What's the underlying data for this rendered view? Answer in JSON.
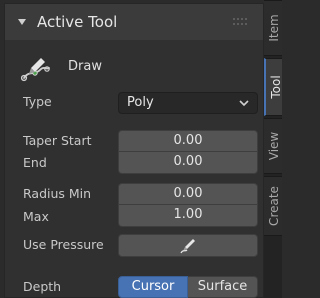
{
  "panel": {
    "title": "Active Tool",
    "tool_name": "Draw"
  },
  "properties": {
    "type_label": "Type",
    "type_value": "Poly",
    "taper_start_label": "Taper Start",
    "taper_start_value": "0.00",
    "end_label": "End",
    "end_value": "0.00",
    "radius_min_label": "Radius Min",
    "radius_min_value": "0.00",
    "max_label": "Max",
    "max_value": "1.00",
    "use_pressure_label": "Use Pressure",
    "depth_label": "Depth",
    "depth_options": [
      "Cursor",
      "Surface"
    ],
    "depth_selected": "Cursor"
  },
  "sidebar": {
    "tabs": [
      {
        "label": "Item",
        "active": false
      },
      {
        "label": "Tool",
        "active": true
      },
      {
        "label": "View",
        "active": false
      },
      {
        "label": "Create",
        "active": false
      }
    ]
  },
  "colors": {
    "accent": "#4772b3",
    "panel_bg": "#303030",
    "field_bg": "#545454"
  },
  "icons": {
    "header": "disclosure-triangle-down-icon",
    "tool": "draw-brush-icon",
    "pressure": "pen-pressure-icon",
    "dropdown": "chevron-down-icon",
    "grip": "drag-grip-icon"
  }
}
